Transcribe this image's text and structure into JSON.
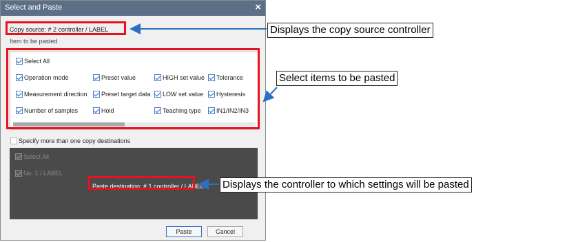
{
  "dialog": {
    "title": "Select and Paste",
    "close_glyph": "×",
    "copy_source": "Copy source: # 2 controller /  LABEL",
    "items_heading": "Item to be pasted",
    "select_all": "Select All",
    "items": [
      {
        "label": "Operation mode",
        "checked": true
      },
      {
        "label": "Preset value",
        "checked": true
      },
      {
        "label": "HIGH set value",
        "checked": true
      },
      {
        "label": "Tolerance",
        "checked": true
      },
      {
        "label": "Measurement direction",
        "checked": true
      },
      {
        "label": "Preset target data",
        "checked": true
      },
      {
        "label": "LOW set value",
        "checked": true
      },
      {
        "label": "Hysteresis",
        "checked": true
      },
      {
        "label": "Number of samples",
        "checked": true
      },
      {
        "label": "Hold",
        "checked": true
      },
      {
        "label": "Teaching type",
        "checked": true
      },
      {
        "label": "IN1/IN2/IN3",
        "checked": true
      }
    ],
    "multiple_destinations": {
      "label": "Specify more than one copy destinations",
      "checked": false
    },
    "destination_panel": {
      "select_all": "Select All",
      "controller_item": "No. 1 /  LABEL",
      "paste_destination": "Paste destination: # 1 controller /  LABEL"
    },
    "buttons": {
      "paste": "Paste",
      "cancel": "Cancel"
    }
  },
  "callouts": {
    "copy_source": "Displays the copy source controller",
    "select_items": "Select items to be pasted",
    "paste_destination": "Displays the controller to which settings will be pasted"
  },
  "colors": {
    "highlight": "#e8111c",
    "arrow": "#2d6fc0",
    "titlebar": "#5b6f86",
    "checkbox": "#4a7fc7"
  },
  "icons": {
    "checkbox": "checkbox-checked-icon",
    "close": "close-icon"
  }
}
